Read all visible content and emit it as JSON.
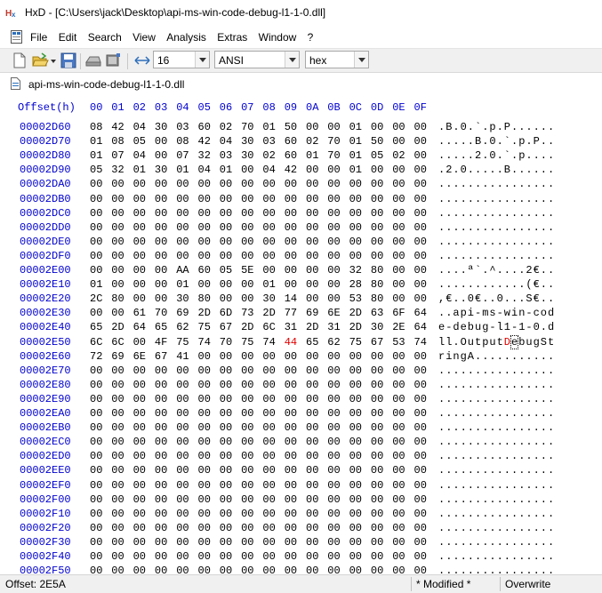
{
  "window": {
    "title": "HxD - [C:\\Users\\jack\\Desktop\\api-ms-win-code-debug-l1-1-0.dll]",
    "app_icon": "hxd-logo-icon"
  },
  "menu": {
    "items": [
      "File",
      "Edit",
      "Search",
      "View",
      "Analysis",
      "Extras",
      "Window",
      "?"
    ]
  },
  "toolbar": {
    "bytes_per_row": "16",
    "charset": "ANSI",
    "offset_base": "hex",
    "icons": [
      "new-file-icon",
      "open-folder-icon",
      "dropdown-icon",
      "save-icon",
      "open-disk-icon",
      "open-ram-icon",
      "bytes-per-row-icon"
    ]
  },
  "tab": {
    "label": "api-ms-win-code-debug-l1-1-0.dll"
  },
  "hex": {
    "offset_header": "Offset(h)",
    "columns": [
      "00",
      "01",
      "02",
      "03",
      "04",
      "05",
      "06",
      "07",
      "08",
      "09",
      "0A",
      "0B",
      "0C",
      "0D",
      "0E",
      "0F"
    ],
    "accent_color": "#0000d0",
    "highlight_color": "#e00000",
    "rows": [
      {
        "offset": "00002D60",
        "bytes": "08 42 04 30 03 60 02 70 01 50 00 00 01 00 00 00",
        "ascii": ".B.0.`.p.P......"
      },
      {
        "offset": "00002D70",
        "bytes": "01 08 05 00 08 42 04 30 03 60 02 70 01 50 00 00",
        "ascii": ".....B.0.`.p.P.."
      },
      {
        "offset": "00002D80",
        "bytes": "01 07 04 00 07 32 03 30 02 60 01 70 01 05 02 00",
        "ascii": ".....2.0.`.p...."
      },
      {
        "offset": "00002D90",
        "bytes": "05 32 01 30 01 04 01 00 04 42 00 00 01 00 00 00",
        "ascii": ".2.0.....B......"
      },
      {
        "offset": "00002DA0",
        "bytes": "00 00 00 00 00 00 00 00 00 00 00 00 00 00 00 00",
        "ascii": "................"
      },
      {
        "offset": "00002DB0",
        "bytes": "00 00 00 00 00 00 00 00 00 00 00 00 00 00 00 00",
        "ascii": "................"
      },
      {
        "offset": "00002DC0",
        "bytes": "00 00 00 00 00 00 00 00 00 00 00 00 00 00 00 00",
        "ascii": "................"
      },
      {
        "offset": "00002DD0",
        "bytes": "00 00 00 00 00 00 00 00 00 00 00 00 00 00 00 00",
        "ascii": "................"
      },
      {
        "offset": "00002DE0",
        "bytes": "00 00 00 00 00 00 00 00 00 00 00 00 00 00 00 00",
        "ascii": "................"
      },
      {
        "offset": "00002DF0",
        "bytes": "00 00 00 00 00 00 00 00 00 00 00 00 00 00 00 00",
        "ascii": "................"
      },
      {
        "offset": "00002E00",
        "bytes": "00 00 00 00 AA 60 05 5E 00 00 00 00 32 80 00 00",
        "ascii": "....ª`.^....2€.."
      },
      {
        "offset": "00002E10",
        "bytes": "01 00 00 00 01 00 00 00 01 00 00 00 28 80 00 00",
        "ascii": "............(€.."
      },
      {
        "offset": "00002E20",
        "bytes": "2C 80 00 00 30 80 00 00 30 14 00 00 53 80 00 00",
        "ascii": ",€..0€..0...S€.."
      },
      {
        "offset": "00002E30",
        "bytes": "00 00 61 70 69 2D 6D 73 2D 77 69 6E 2D 63 6F 64",
        "ascii": "..api-ms-win-cod"
      },
      {
        "offset": "00002E40",
        "bytes": "65 2D 64 65 62 75 67 2D 6C 31 2D 31 2D 30 2E 64",
        "ascii": "e-debug-l1-1-0.d"
      },
      {
        "offset": "00002E50",
        "bytes": "6C 6C 00 4F 75 74 70 75 74 44 65 62 75 67 53 74",
        "ascii": "ll.OutputDebugSt",
        "hl_byte": 9
      },
      {
        "offset": "00002E60",
        "bytes": "72 69 6E 67 41 00 00 00 00 00 00 00 00 00 00 00",
        "ascii": "ringA..........."
      },
      {
        "offset": "00002E70",
        "bytes": "00 00 00 00 00 00 00 00 00 00 00 00 00 00 00 00",
        "ascii": "................"
      },
      {
        "offset": "00002E80",
        "bytes": "00 00 00 00 00 00 00 00 00 00 00 00 00 00 00 00",
        "ascii": "................"
      },
      {
        "offset": "00002E90",
        "bytes": "00 00 00 00 00 00 00 00 00 00 00 00 00 00 00 00",
        "ascii": "................"
      },
      {
        "offset": "00002EA0",
        "bytes": "00 00 00 00 00 00 00 00 00 00 00 00 00 00 00 00",
        "ascii": "................"
      },
      {
        "offset": "00002EB0",
        "bytes": "00 00 00 00 00 00 00 00 00 00 00 00 00 00 00 00",
        "ascii": "................"
      },
      {
        "offset": "00002EC0",
        "bytes": "00 00 00 00 00 00 00 00 00 00 00 00 00 00 00 00",
        "ascii": "................"
      },
      {
        "offset": "00002ED0",
        "bytes": "00 00 00 00 00 00 00 00 00 00 00 00 00 00 00 00",
        "ascii": "................"
      },
      {
        "offset": "00002EE0",
        "bytes": "00 00 00 00 00 00 00 00 00 00 00 00 00 00 00 00",
        "ascii": "................"
      },
      {
        "offset": "00002EF0",
        "bytes": "00 00 00 00 00 00 00 00 00 00 00 00 00 00 00 00",
        "ascii": "................"
      },
      {
        "offset": "00002F00",
        "bytes": "00 00 00 00 00 00 00 00 00 00 00 00 00 00 00 00",
        "ascii": "................"
      },
      {
        "offset": "00002F10",
        "bytes": "00 00 00 00 00 00 00 00 00 00 00 00 00 00 00 00",
        "ascii": "................"
      },
      {
        "offset": "00002F20",
        "bytes": "00 00 00 00 00 00 00 00 00 00 00 00 00 00 00 00",
        "ascii": "................"
      },
      {
        "offset": "00002F30",
        "bytes": "00 00 00 00 00 00 00 00 00 00 00 00 00 00 00 00",
        "ascii": "................"
      },
      {
        "offset": "00002F40",
        "bytes": "00 00 00 00 00 00 00 00 00 00 00 00 00 00 00 00",
        "ascii": "................"
      },
      {
        "offset": "00002F50",
        "bytes": "00 00 00 00 00 00 00 00 00 00 00 00 00 00 00 00",
        "ascii": "................"
      }
    ]
  },
  "status": {
    "offset": "Offset: 2E5A",
    "modified": "* Modified *",
    "mode": "Overwrite"
  }
}
